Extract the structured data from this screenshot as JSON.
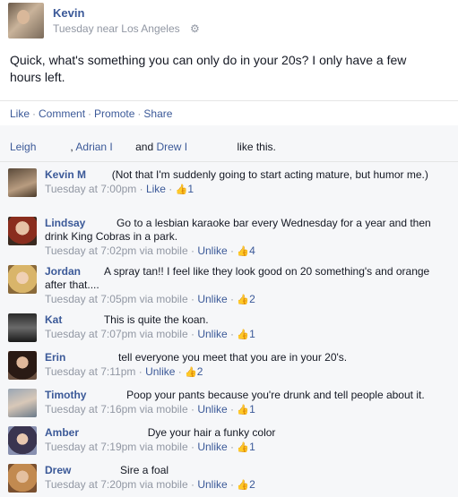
{
  "post": {
    "author": "Kevin",
    "meta": "Tuesday near Los Angeles",
    "gear_icon": "⚙",
    "text": "Quick, what's something you can only do in your 20s? I only have a few hours left.",
    "actions": {
      "like": "Like",
      "comment": "Comment",
      "promote": "Promote",
      "share": "Share",
      "separator": "·"
    }
  },
  "likes": {
    "name1": "Leigh",
    "name2": "Adrian I",
    "and": "and",
    "name3": "Drew I",
    "suffix": "like this."
  },
  "comments": [
    {
      "name": "Kevin M",
      "text": "(Not that I'm suddenly going to start acting mature, but humor me.)",
      "time": "Tuesday at 7:00pm",
      "via": "",
      "action": "Like",
      "likes": "1"
    },
    {
      "name": "Lindsay",
      "text": "Go to a lesbian karaoke bar every Wednesday for a year and then drink King Cobras in a park.",
      "time": "Tuesday at 7:02pm",
      "via": "via mobile",
      "action": "Unlike",
      "likes": "4"
    },
    {
      "name": "Jordan",
      "text": "A spray tan!! I feel like they look good on 20 something's and orange after that....",
      "time": "Tuesday at 7:05pm",
      "via": "via mobile",
      "action": "Unlike",
      "likes": "2"
    },
    {
      "name": "Kat",
      "text": "This is quite the koan.",
      "time": "Tuesday at 7:07pm",
      "via": "via mobile",
      "action": "Unlike",
      "likes": "1"
    },
    {
      "name": "Erin",
      "text": "tell everyone you meet that you are in your 20's.",
      "time": "Tuesday at 7:11pm",
      "via": "",
      "action": "Unlike",
      "likes": "2"
    },
    {
      "name": "Timothy",
      "text": "Poop your pants because you're drunk and tell people about it.",
      "time": "Tuesday at 7:16pm",
      "via": "via mobile",
      "action": "Unlike",
      "likes": "1"
    },
    {
      "name": "Amber",
      "text": "Dye your hair a funky color",
      "time": "Tuesday at 7:19pm",
      "via": "via mobile",
      "action": "Unlike",
      "likes": "1"
    },
    {
      "name": "Drew",
      "text": "Sire a foal",
      "time": "Tuesday at 7:20pm",
      "via": "via mobile",
      "action": "Unlike",
      "likes": "2"
    }
  ],
  "icons": {
    "thumb": "thumbs-up-icon",
    "gear": "gear-icon"
  },
  "colors": {
    "link": "#3b5998",
    "meta": "#9197a3",
    "ufi_bg": "#f6f7f9"
  }
}
